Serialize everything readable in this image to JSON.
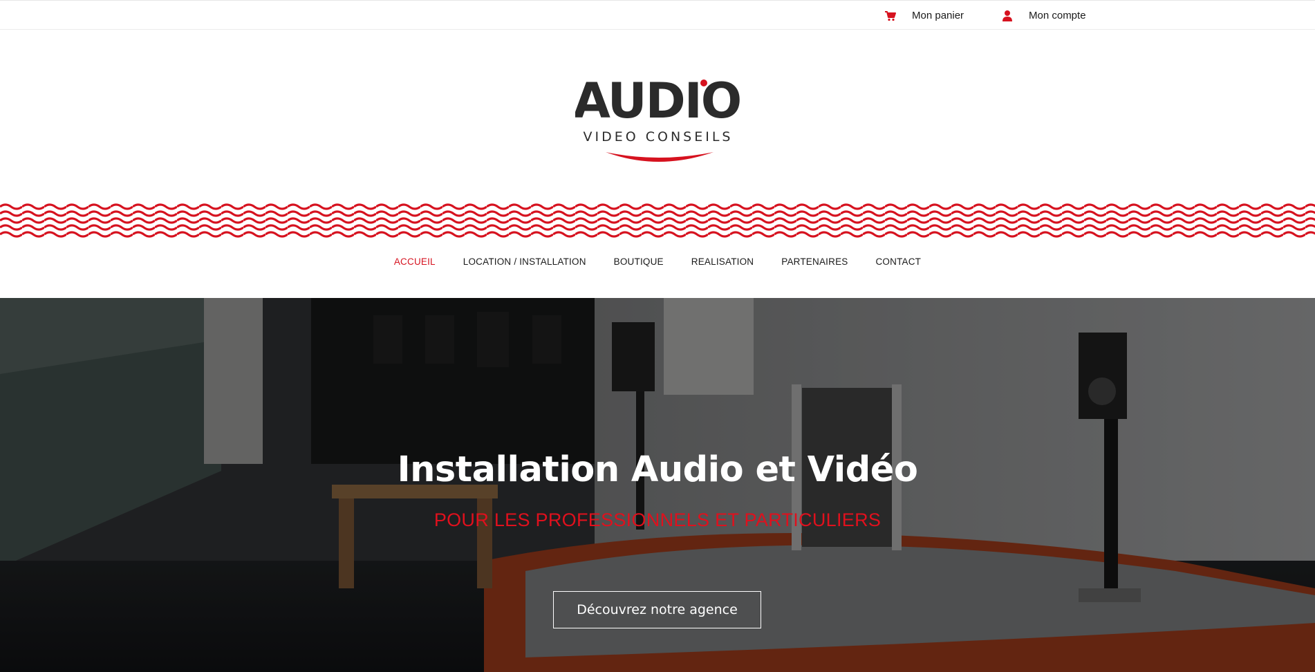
{
  "topbar": {
    "cart_label": "Mon panier",
    "account_label": "Mon compte",
    "cart_icon": "shopping-cart-icon",
    "account_icon": "user-icon"
  },
  "logo": {
    "main": "AUDIO",
    "sub": "VIDEO CONSEILS"
  },
  "nav": {
    "items": [
      {
        "label": "ACCUEIL",
        "active": true
      },
      {
        "label": "LOCATION / INSTALLATION",
        "active": false
      },
      {
        "label": "BOUTIQUE",
        "active": false
      },
      {
        "label": "REALISATION",
        "active": false
      },
      {
        "label": "PARTENAIRES",
        "active": false
      },
      {
        "label": "CONTACT",
        "active": false
      }
    ]
  },
  "hero": {
    "title": "Installation Audio et Vidéo",
    "subtitle": "POUR LES PROFESSIONNELS ET PARTICULIERS",
    "button_label": "Découvrez notre agence"
  },
  "colors": {
    "accent": "#d6121f",
    "text": "#1a1a1a",
    "logo_dark": "#2b2b2b"
  }
}
